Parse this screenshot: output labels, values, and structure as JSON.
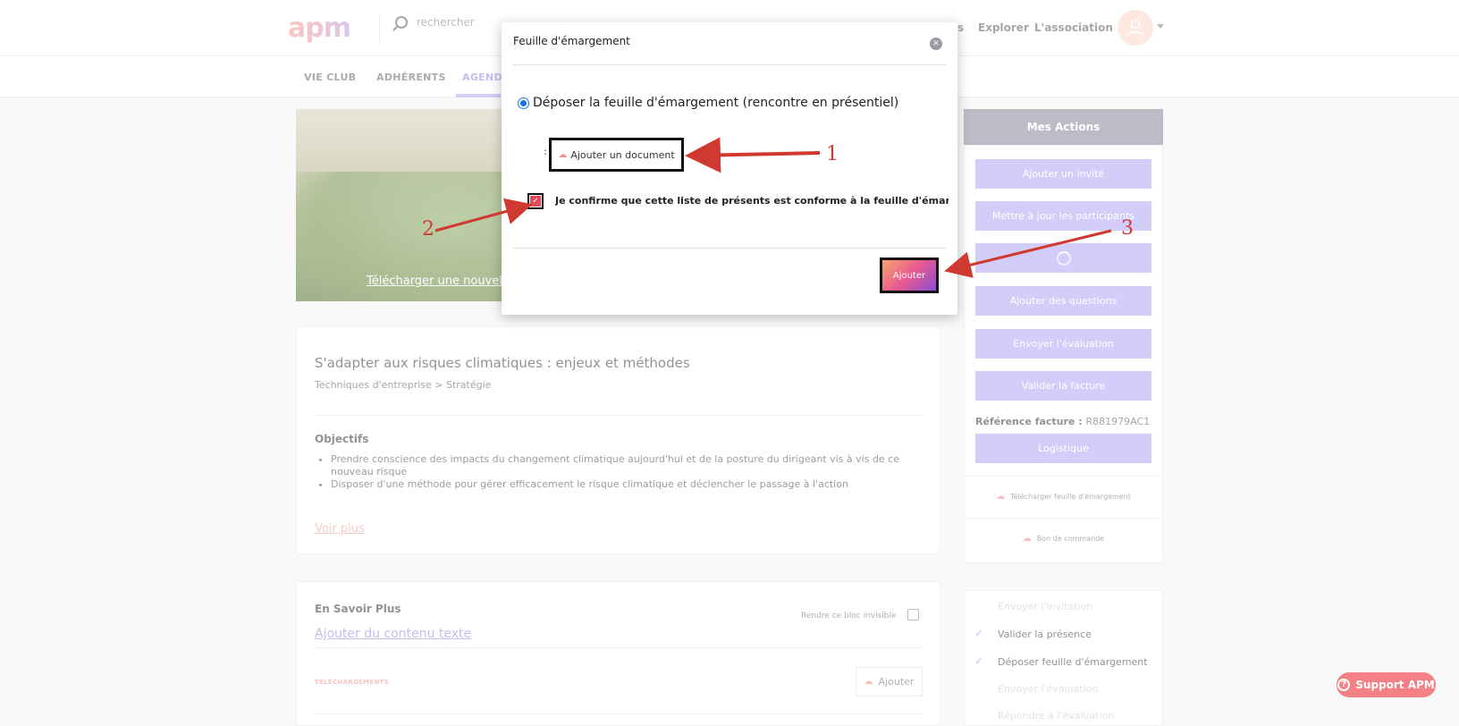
{
  "header": {
    "logo": "apm",
    "search_placeholder": "rechercher",
    "nav_partial": "s",
    "nav": [
      "Explorer",
      "L'association"
    ]
  },
  "subnav": {
    "tabs": [
      "VIE CLUB",
      "ADHÉRENTS",
      "AGENDA"
    ]
  },
  "hero": {
    "upload_link": "Télécharger une nouvel"
  },
  "event": {
    "title": "S'adapter aux risques climatiques : enjeux et méthodes",
    "breadcrumb": "Techniques d'entreprise > Stratégie",
    "objectives_title": "Objectifs",
    "objectives": [
      "Prendre conscience des impacts du changement climatique aujourd'hui et de la posture du dirigeant vis à vis de ce nouveau risque",
      "Disposer d'une méthode pour gérer efficacement le risque climatique et déclencher le passage à l'action"
    ],
    "voir_plus": "Voir plus"
  },
  "savoir": {
    "title": "En Savoir Plus",
    "add_text": "Ajouter du contenu texte",
    "invisible_label": "Rendre ce bloc invisible",
    "downloads_label": "TÉLÉCHARGEMENTS",
    "add_button": "Ajouter"
  },
  "sidebar": {
    "header": "Mes Actions",
    "buttons": [
      "Ajouter un invité",
      "Mettre à jour les participants",
      "",
      "Ajouter des questions",
      "Envoyer l'évaluation",
      "Valider la facture"
    ],
    "ref_label": "Référence facture :",
    "ref_value": "R881979AC1",
    "logistique": "Logistique",
    "links": [
      "Télécharger feuille d'émargement",
      "Bon de commande"
    ],
    "checklist": [
      {
        "label": "Envoyer l'invitation",
        "done": false
      },
      {
        "label": "Valider la présence",
        "done": true
      },
      {
        "label": "Déposer feuille d'émargement",
        "done": true
      },
      {
        "label": "Envoyer l'évaluation",
        "done": false
      },
      {
        "label": "Répondre à l'évaluation",
        "done": false
      }
    ]
  },
  "support": {
    "label": "Support APM"
  },
  "modal": {
    "title": "Feuille d'émargement",
    "close_glyph": "×",
    "radio_label": "Déposer la feuille d'émargement (rencontre en présentiel)",
    "colon": ":",
    "add_document": "Ajouter un document",
    "checkbox_checked": true,
    "confirm_text": "Je confirme que cette liste de présents est conforme à la feuille d'émargement",
    "submit": "Ajouter"
  },
  "annotations": {
    "labels": [
      "1",
      "2",
      "3"
    ],
    "color": "#d0392f"
  },
  "colors": {
    "accent": "#b3aaf5",
    "accent_text": "#9a8de8",
    "support_red": "#e8252b"
  }
}
